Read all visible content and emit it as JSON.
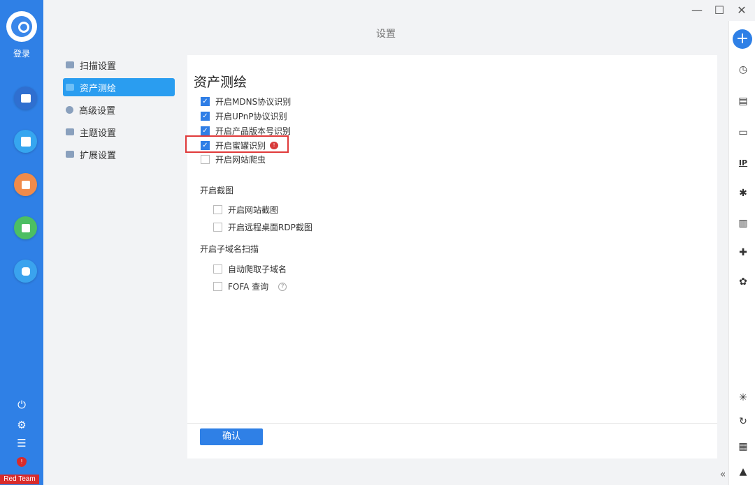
{
  "app": {
    "window_title": "设置",
    "login_label": "登录",
    "brand_badge": "Red Team"
  },
  "window_controls": {
    "minimize": "—",
    "maximize": "☐",
    "close": "✕"
  },
  "nav": {
    "items": [
      {
        "label": "扫描设置",
        "active": false
      },
      {
        "label": "资产测绘",
        "active": true
      },
      {
        "label": "高级设置",
        "active": false
      },
      {
        "label": "主题设置",
        "active": false
      },
      {
        "label": "扩展设置",
        "active": false
      }
    ]
  },
  "panel": {
    "title": "资产测绘",
    "options": [
      {
        "label": "开启MDNS协议识别",
        "checked": true
      },
      {
        "label": "开启UPnP协议识别",
        "checked": true
      },
      {
        "label": "开启产品版本号识别",
        "checked": true
      },
      {
        "label": "开启蜜罐识别",
        "checked": true
      },
      {
        "label": "开启网站爬虫",
        "checked": false
      }
    ],
    "screenshot_section": {
      "label": "开启截图",
      "options": [
        {
          "label": "开启网站截图",
          "checked": false
        },
        {
          "label": "开启远程桌面RDP截图",
          "checked": false
        }
      ]
    },
    "subdomain_section": {
      "label": "开启子域名扫描",
      "options": [
        {
          "label": "自动爬取子域名",
          "checked": false
        },
        {
          "label": "FOFA 查询",
          "checked": false
        }
      ]
    },
    "help_symbol": "?",
    "confirm_label": "确认"
  },
  "right_rail": {
    "icons": [
      "plus-icon",
      "clock-icon",
      "document-icon",
      "monitor-icon",
      "ip-icon",
      "bug-icon",
      "bar-chart-icon",
      "plugin-icon",
      "settings-plugin-icon",
      "debug-icon",
      "refresh-icon",
      "notes-icon",
      "warning-icon",
      "collapse-icon"
    ],
    "ip_label": "IP",
    "collapse_label": "«"
  },
  "colors": {
    "primary": "#2f80e6",
    "active_nav": "#2a9df0",
    "highlight": "#e03a3a"
  }
}
